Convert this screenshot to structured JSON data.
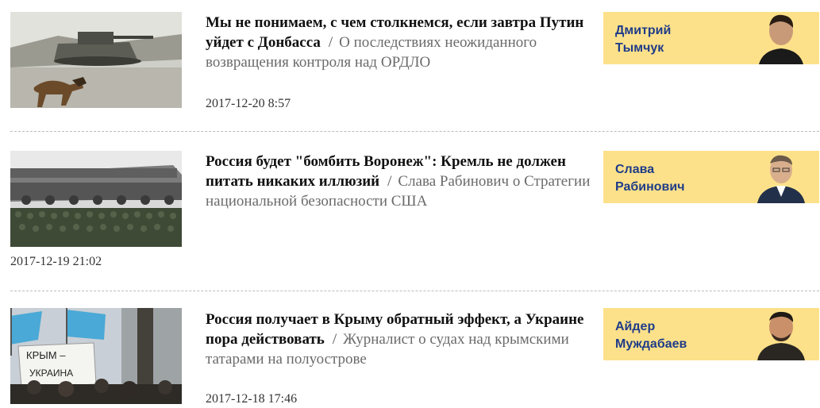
{
  "articles": [
    {
      "title": "Мы не понимаем, с чем столкнемся, если завтра Путин уйдет с Донбасса",
      "separator": "/",
      "subtitle": "О последствиях неожиданного возвращения контроля над ОРДЛО",
      "date": "2017-12-20 8:57",
      "author": {
        "first": "Дмитрий",
        "last": "Тымчук"
      },
      "image": "tank-and-dog-photo"
    },
    {
      "title": "Россия будет \"бомбить Воронеж\": Кремль не должен питать никаких иллюзий",
      "separator": "/",
      "subtitle": "Слава Рабинович о Стратегии национальной безопасности США",
      "date": "2017-12-19 21:02",
      "author": {
        "first": "Слава",
        "last": "Рабинович"
      },
      "image": "missile-parade-photo"
    },
    {
      "title": "Россия получает в Крыму обратный эффект, а Украине пора действовать",
      "separator": "/",
      "subtitle": "Журналист о судах над крымскими татарами на полуострове",
      "date": "2017-12-18 17:46",
      "author": {
        "first": "Айдер",
        "last": "Муждабаев"
      },
      "image": "crimea-protest-photo",
      "sign_text": "КРЫМ – УКРАИНА"
    }
  ],
  "colors": {
    "author_bg": "#fde18a",
    "author_name": "#1f3c88"
  }
}
